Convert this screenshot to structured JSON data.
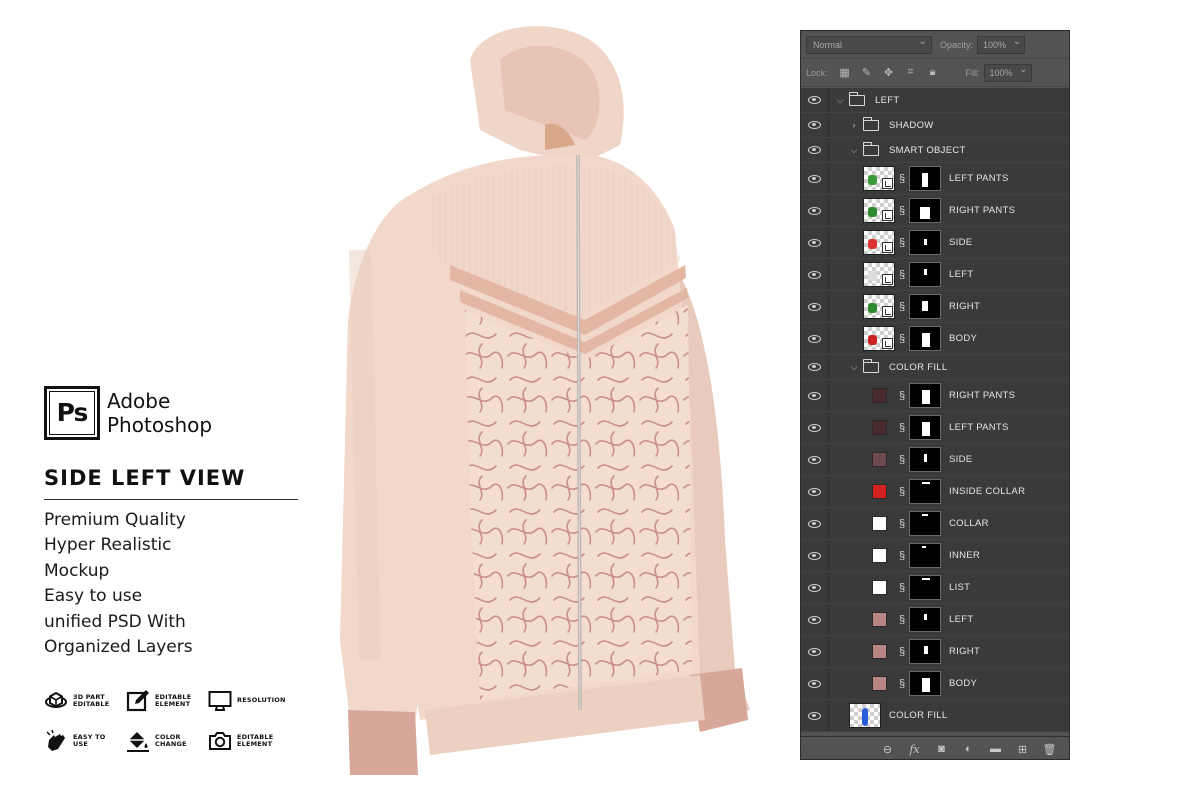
{
  "brand": {
    "logo_text": "Ps",
    "name_line1": "Adobe",
    "name_line2": "Photoshop"
  },
  "view_title": "SIDE LEFT VIEW",
  "features": [
    "Premium Quality",
    "Hyper Realistic",
    "Mockup",
    "Easy to use",
    "unified PSD With",
    "Organized Layers"
  ],
  "badges": [
    {
      "icon": "3d-cube-icon",
      "label": "3D PART EDITABLE"
    },
    {
      "icon": "edit-pencil-icon",
      "label": "EDITABLE ELEMENT"
    },
    {
      "icon": "monitor-icon",
      "label": "RESOLUTION"
    },
    {
      "icon": "pointer-hand-icon",
      "label": "EASY TO USE"
    },
    {
      "icon": "paint-bucket-icon",
      "label": "COLOR CHANGE"
    },
    {
      "icon": "camera-icon",
      "label": "EDITABLE ELEMENT"
    }
  ],
  "product": {
    "colors": {
      "body": "#f1d8cb",
      "shade": "#e4c2b2",
      "cuff": "#d7a79a",
      "pattern": "#c98f88",
      "stripe": "#e3b7a4",
      "zipper": "#b9b2ae"
    }
  },
  "panel": {
    "blend_mode": "Normal",
    "opacity_label": "Opacity:",
    "opacity_value": "100%",
    "lock_label": "Lock:",
    "fill_label": "Fill:",
    "fill_value": "100%",
    "layers": [
      {
        "name": "LEFT",
        "kind": "group",
        "expanded": true,
        "indent": 0
      },
      {
        "name": "SHADOW",
        "kind": "group",
        "expanded": false,
        "indent": 1
      },
      {
        "name": "SMART OBJECT",
        "kind": "group",
        "expanded": true,
        "indent": 1
      },
      {
        "name": "LEFT PANTS",
        "kind": "smart",
        "indent": 2,
        "blob": "#3a9a3a"
      },
      {
        "name": "RIGHT PANTS",
        "kind": "smart",
        "indent": 2,
        "blob": "#2e8a2e"
      },
      {
        "name": "SIDE",
        "kind": "smart",
        "indent": 2,
        "blob": "#d33"
      },
      {
        "name": "LEFT",
        "kind": "smart",
        "indent": 2,
        "blob": "#ddd"
      },
      {
        "name": "RIGHT",
        "kind": "smart",
        "indent": 2,
        "blob": "#2e8a2e"
      },
      {
        "name": "BODY",
        "kind": "smart",
        "indent": 2,
        "blob": "#c22"
      },
      {
        "name": "COLOR FILL",
        "kind": "group",
        "expanded": true,
        "indent": 1
      },
      {
        "name": "RIGHT PANTS",
        "kind": "fill",
        "indent": 2,
        "color": "#4a2a2c"
      },
      {
        "name": "LEFT PANTS",
        "kind": "fill",
        "indent": 2,
        "color": "#4a2a2c"
      },
      {
        "name": "SIDE",
        "kind": "fill",
        "indent": 2,
        "color": "#6e4a4e"
      },
      {
        "name": "INSIDE COLLAR",
        "kind": "fill",
        "indent": 2,
        "color": "#d42020"
      },
      {
        "name": "COLLAR",
        "kind": "fill",
        "indent": 2,
        "color": "#ffffff"
      },
      {
        "name": "INNER",
        "kind": "fill",
        "indent": 2,
        "color": "#ffffff"
      },
      {
        "name": "LIST",
        "kind": "fill",
        "indent": 2,
        "color": "#ffffff"
      },
      {
        "name": "LEFT",
        "kind": "fill",
        "indent": 2,
        "color": "#b88582"
      },
      {
        "name": "RIGHT",
        "kind": "fill",
        "indent": 2,
        "color": "#b88582"
      },
      {
        "name": "BODY",
        "kind": "fill",
        "indent": 2,
        "color": "#b88582"
      },
      {
        "name": "COLOR FILL",
        "kind": "image",
        "indent": 0
      }
    ],
    "bottom_icons": [
      "link-layers-icon",
      "fx-icon",
      "add-mask-icon",
      "adjustment-layer-icon",
      "new-group-icon",
      "new-layer-icon",
      "delete-layer-icon"
    ]
  }
}
